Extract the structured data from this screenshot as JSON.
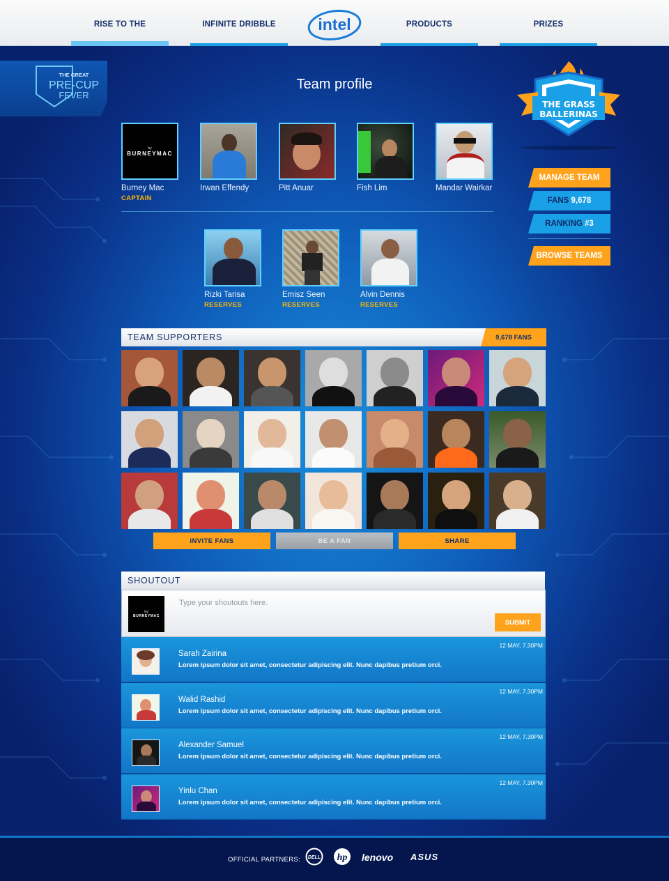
{
  "nav": {
    "items": [
      {
        "label": "RISE TO THE CHALLENGE",
        "active": true
      },
      {
        "label": "INFINITE DRIBBLE",
        "active": false
      },
      {
        "label": "PRODUCTS",
        "active": false
      },
      {
        "label": "PRIZES",
        "active": false
      }
    ],
    "logo": "intel"
  },
  "promo": {
    "line1": "THE GREAT",
    "line2": "PRE-CUP",
    "line3": "FEVER"
  },
  "page_title": "Team profile",
  "team": {
    "badge_line1": "THE GRASS",
    "badge_line2": "BALLERINAS",
    "fans_label": "FANS",
    "fans_value": "9,678",
    "ranking_label": "RANKING",
    "ranking_value": "#3",
    "manage_label": "MANAGE TEAM",
    "browse_label": "BROWSE TEAMS"
  },
  "members": [
    {
      "name": "Burney Mac",
      "role": "CAPTAIN"
    },
    {
      "name": "Irwan Effendy",
      "role": ""
    },
    {
      "name": "Pitt Anuar",
      "role": ""
    },
    {
      "name": "Fish Lim",
      "role": ""
    },
    {
      "name": "Mandar Wairkar",
      "role": ""
    }
  ],
  "reserves": [
    {
      "name": "Rizki Tarisa",
      "role": "RESERVES"
    },
    {
      "name": "Emisz Seen",
      "role": "RESERVES"
    },
    {
      "name": "Alvin Dennis",
      "role": "RESERVES"
    }
  ],
  "burney_logo": {
    "by": "by",
    "text": "BURNEYMAC"
  },
  "supporters": {
    "title": "TEAM SUPPORTERS",
    "fans_tag": "9,678 FANS",
    "invite_label": "INVITE FANS",
    "be_fan_label": "BE A FAN",
    "share_label": "SHARE"
  },
  "shoutout": {
    "title": "SHOUTOUT",
    "placeholder": "Type your shoutouts here.",
    "submit_label": "SUBMIT",
    "posts": [
      {
        "name": "Sarah Zairina",
        "message": "Lorem ipsum dolor sit amet, consectetur adipiscing elit. Nunc dapibus pretium orci.",
        "time": "12 MAY, 7.30PM"
      },
      {
        "name": "Walid Rashid",
        "message": "Lorem ipsum dolor sit amet, consectetur adipiscing elit. Nunc dapibus pretium orci.",
        "time": "12 MAY, 7.30PM"
      },
      {
        "name": "Alexander Samuel",
        "message": "Lorem ipsum dolor sit amet, consectetur adipiscing elit. Nunc dapibus pretium orci.",
        "time": "12 MAY, 7.30PM"
      },
      {
        "name": "Yinlu Chan",
        "message": "Lorem ipsum dolor sit amet, consectetur adipiscing elit. Nunc dapibus pretium orci.",
        "time": "12 MAY, 7.30PM"
      }
    ]
  },
  "footer": {
    "partners_label": "OFFICIAL PARTNERS:",
    "partners": [
      "DELL",
      "hp",
      "lenovo",
      "ASUS"
    ]
  },
  "colors": {
    "accent_orange": "#ffa21c",
    "accent_blue": "#1aa0e6",
    "reserve_yellow": "#ffb600",
    "navy": "#061a55"
  }
}
